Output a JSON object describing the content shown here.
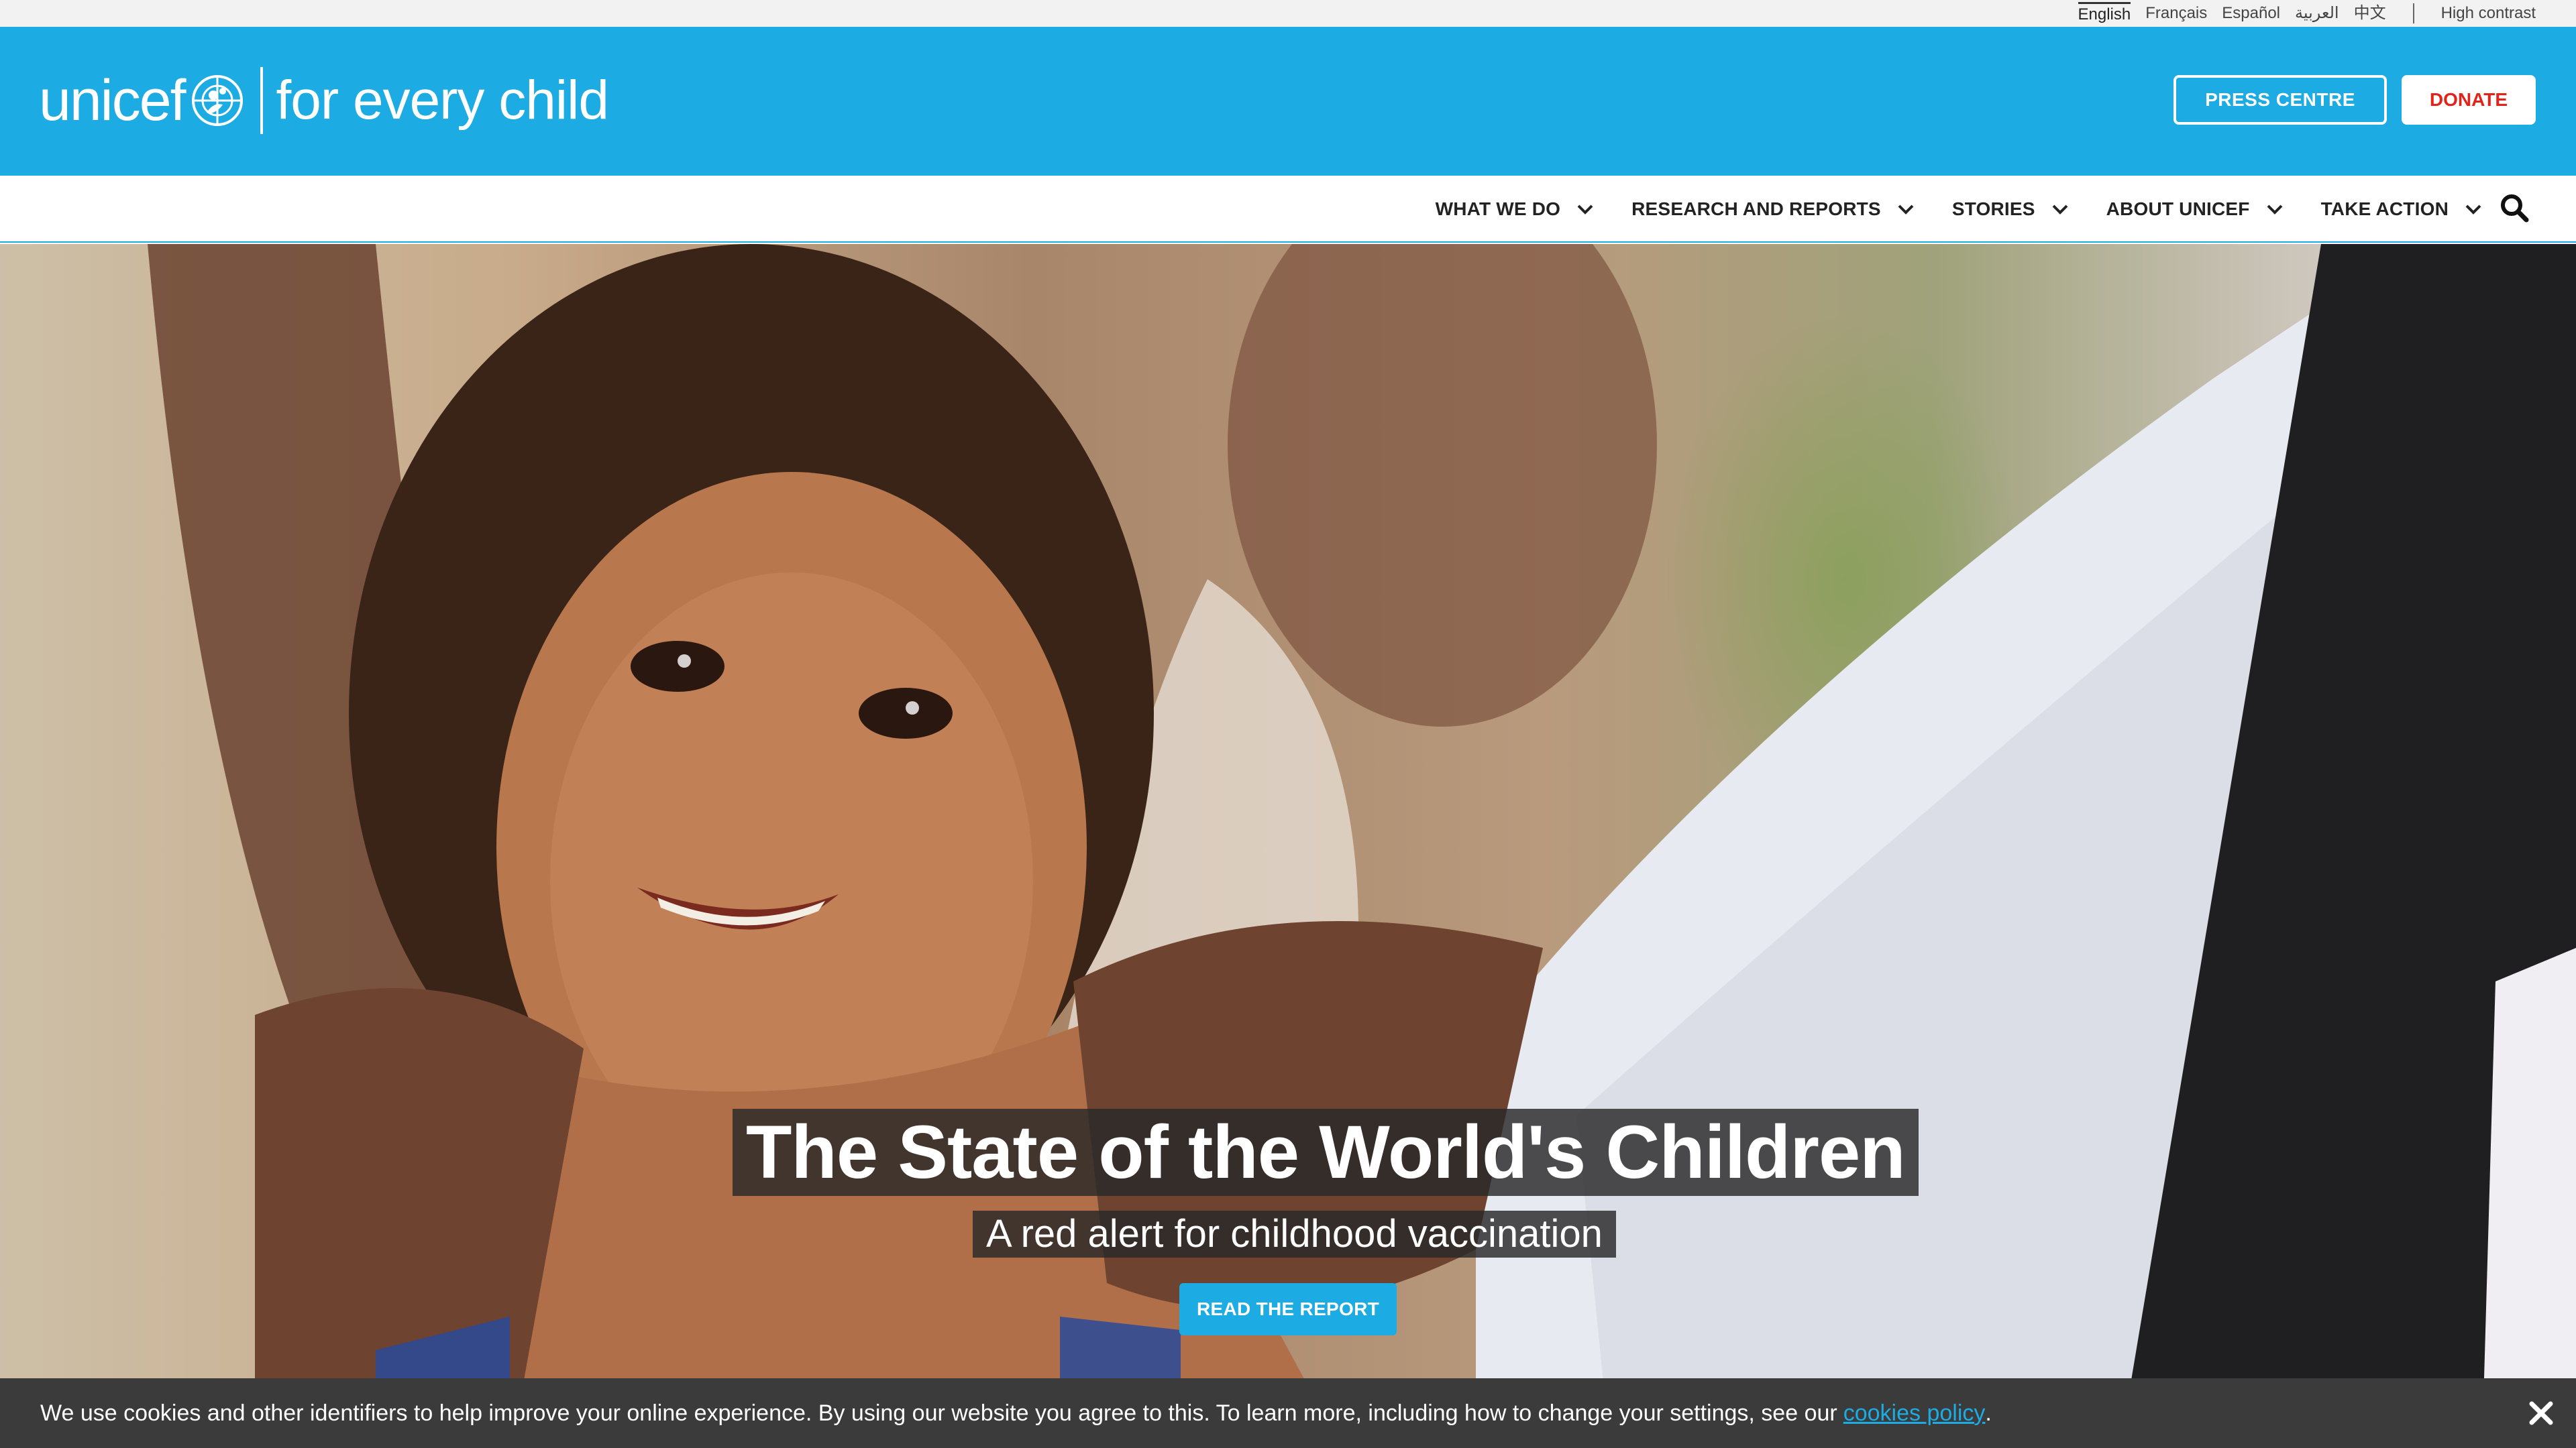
{
  "utility": {
    "languages": [
      "English",
      "Français",
      "Español",
      "العربية",
      "中文"
    ],
    "active_language": "English",
    "high_contrast": "High contrast"
  },
  "header": {
    "logo_word": "unicef",
    "tagline": "for every child",
    "press_centre": "PRESS CENTRE",
    "donate": "DONATE"
  },
  "nav": {
    "items": [
      "WHAT WE DO",
      "RESEARCH AND REPORTS",
      "STORIES",
      "ABOUT UNICEF",
      "TAKE ACTION"
    ],
    "search_icon": "search-icon"
  },
  "hero": {
    "title": "The State of the World's Children",
    "subtitle": "A red alert for childhood vaccination",
    "cta": "READ THE REPORT"
  },
  "cookie": {
    "text": "We use cookies and other identifiers to help improve your online experience. By using our website you agree to this. To learn more, including how to change your settings, see our",
    "link": "cookies policy",
    "suffix": ".",
    "close_icon": "close-icon"
  },
  "colors": {
    "brand": "#1cabe2",
    "donate": "#e2231a",
    "cookie_bg": "#3b3b3b"
  }
}
